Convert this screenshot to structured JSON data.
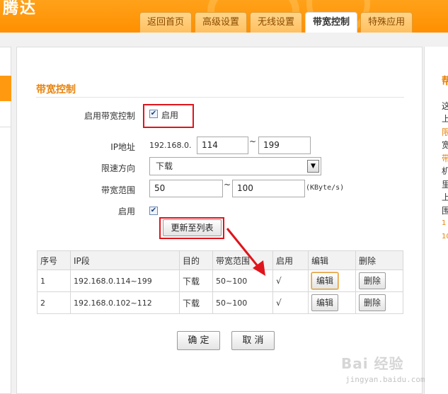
{
  "header": {
    "brand": "腾达",
    "tabs": [
      {
        "label": "返回首页"
      },
      {
        "label": "高级设置"
      },
      {
        "label": "无线设置"
      },
      {
        "label": "带宽控制",
        "active": true
      },
      {
        "label": "特殊应用"
      }
    ]
  },
  "form": {
    "section_title": "带宽控制",
    "enable_label": "启用带宽控制",
    "enable_checkbox_label": "启用",
    "enable_checked": true,
    "ip_label": "IP地址",
    "ip_prefix": "192.168.0.",
    "ip_start": "114",
    "ip_end": "199",
    "tilde": "~",
    "direction_label": "限速方向",
    "direction_value": "下载",
    "bandwidth_label": "带宽范围",
    "bw_min": "50",
    "bw_max": "100",
    "bw_unit": "(KByte/s)",
    "enable2_label": "启用",
    "enable2_checked": true,
    "update_button": "更新至列表"
  },
  "table": {
    "headers": [
      "序号",
      "IP段",
      "目的",
      "带宽范围",
      "启用",
      "编辑",
      "删除"
    ],
    "rows": [
      {
        "no": "1",
        "ip": "192.168.0.114~199",
        "dest": "下载",
        "bw": "50~100",
        "enabled": "√",
        "edit": "编辑",
        "delete": "删除"
      },
      {
        "no": "2",
        "ip": "192.168.0.102~112",
        "dest": "下载",
        "bw": "50~100",
        "enabled": "√",
        "edit": "编辑",
        "delete": "删除"
      }
    ]
  },
  "footer": {
    "ok_button": "确 定",
    "cancel_button": "取 消"
  },
  "help_panel": {
    "title": "帮",
    "lines": [
      "这",
      "上",
      "限",
      "宽",
      "带",
      "机",
      "里",
      "上",
      "围",
      "1",
      "10"
    ]
  },
  "watermark": {
    "text": "Bai 经验",
    "url": "jingyan.baidu.com"
  },
  "colors": {
    "header_orange": "#ff9a10",
    "section_orange": "#e8830c",
    "annotation_red": "#e0141c"
  }
}
